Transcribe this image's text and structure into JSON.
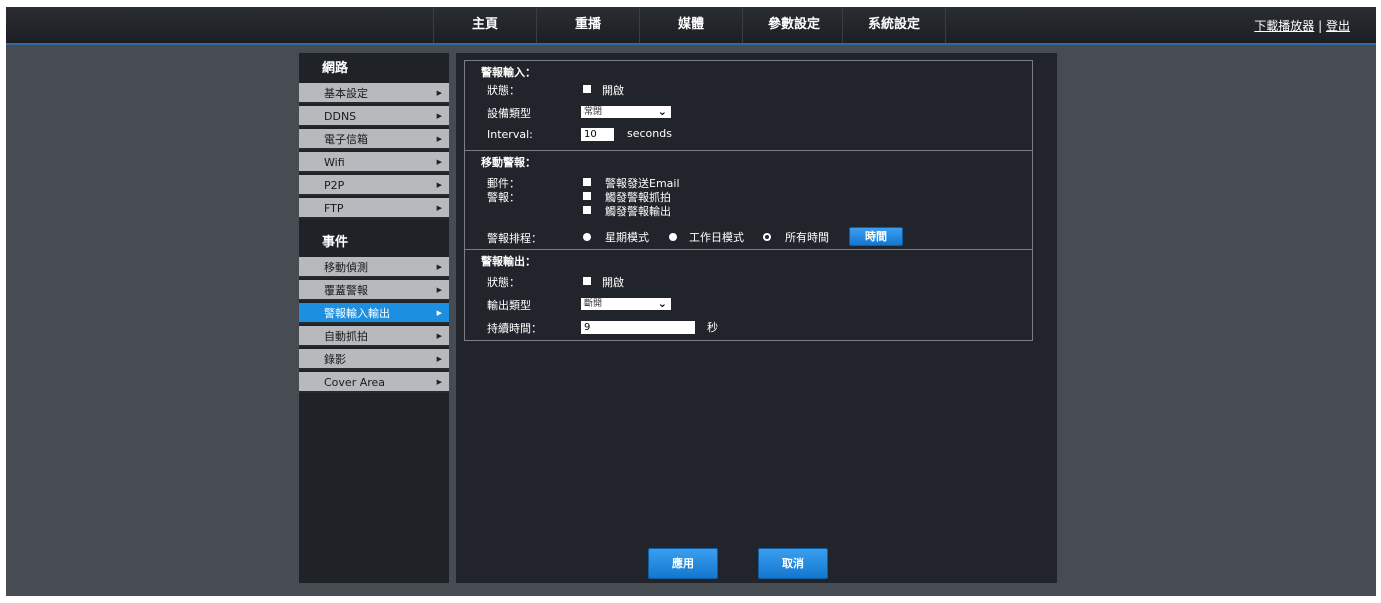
{
  "topnav": {
    "items": [
      "主頁",
      "重播",
      "媒體",
      "參數設定",
      "系統設定"
    ],
    "download_player": "下載播放器",
    "separator": "|",
    "logout": "登出"
  },
  "sidebar": {
    "network_title": "網路",
    "network_items": [
      "基本設定",
      "DDNS",
      "電子信箱",
      "Wifi",
      "P2P",
      "FTP"
    ],
    "event_title": "事件",
    "event_items": [
      "移動偵測",
      "覆蓋警報",
      "警報輸入輸出",
      "自動抓拍",
      "錄影",
      "Cover Area"
    ],
    "active_item": "警報輸入輸出"
  },
  "alarm_input": {
    "title": "警報輸入：",
    "status_label": "狀態：",
    "status_checkbox": "開啟",
    "device_type_label": "設備類型",
    "device_type_value": "常閉",
    "interval_label": "Interval:",
    "interval_value": "10",
    "interval_unit": "seconds"
  },
  "motion_alarm": {
    "title": "移動警報：",
    "mail_label": "郵件：",
    "mail_option": "警報發送Email",
    "alarm_label": "警報：",
    "alarm_option_capture": "觸發警報抓拍",
    "alarm_option_output": "觸發警報輸出",
    "schedule_label": "警報排程：",
    "schedule_weekly": "星期模式",
    "schedule_workday": "工作日模式",
    "schedule_all": "所有時間",
    "time_button": "時間"
  },
  "alarm_output": {
    "title": "警報輸出：",
    "status_label": "狀態：",
    "status_checkbox": "開啟",
    "output_type_label": "輸出類型",
    "output_type_value": "斷開",
    "duration_label": "持續時間：",
    "duration_value": "9",
    "duration_unit": "秒"
  },
  "actions": {
    "apply": "應用",
    "cancel": "取消"
  }
}
